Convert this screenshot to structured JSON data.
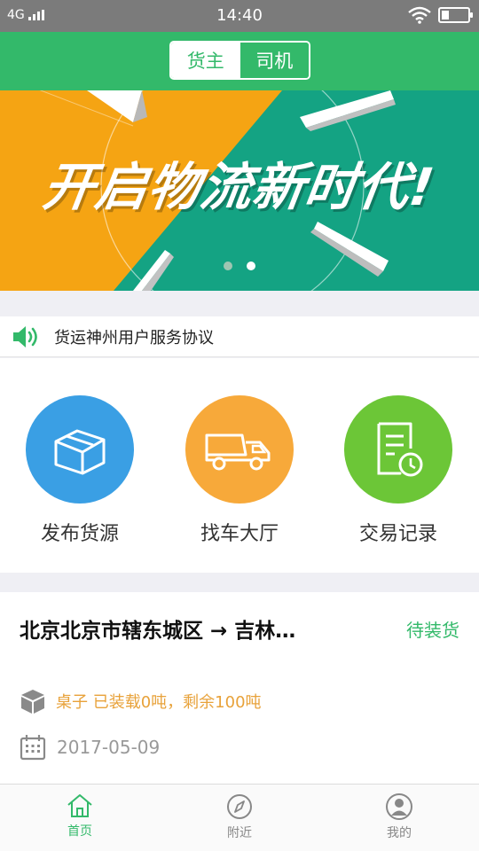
{
  "status_bar": {
    "network": "4G",
    "time": "14:40"
  },
  "header": {
    "roles": [
      {
        "label": "货主",
        "active": true
      },
      {
        "label": "司机",
        "active": false
      }
    ]
  },
  "banner": {
    "text": "开启物流新时代!",
    "slide_count": 2,
    "active_slide": 2
  },
  "notice": {
    "icon": "speaker-icon",
    "text": "货运神州用户服务协议"
  },
  "actions": [
    {
      "label": "发布货源",
      "icon": "box-icon",
      "color": "#3a9fe4"
    },
    {
      "label": "找车大厅",
      "icon": "truck-icon",
      "color": "#f7a93a"
    },
    {
      "label": "交易记录",
      "icon": "document-clock-icon",
      "color": "#6cc637"
    }
  ],
  "order": {
    "route": "北京北京市辖东城区 → 吉林…",
    "status": "待装货",
    "cargo": "桌子 已装载0吨，剩余100吨",
    "date": "2017-05-09"
  },
  "tabs": [
    {
      "label": "首页",
      "icon": "home-icon",
      "active": true
    },
    {
      "label": "附近",
      "icon": "compass-icon",
      "active": false
    },
    {
      "label": "我的",
      "icon": "user-icon",
      "active": false
    }
  ],
  "colors": {
    "brand_green": "#33b96a",
    "banner_orange": "#f5a413",
    "banner_teal": "#14a383",
    "cargo_orange": "#e8a23a"
  }
}
